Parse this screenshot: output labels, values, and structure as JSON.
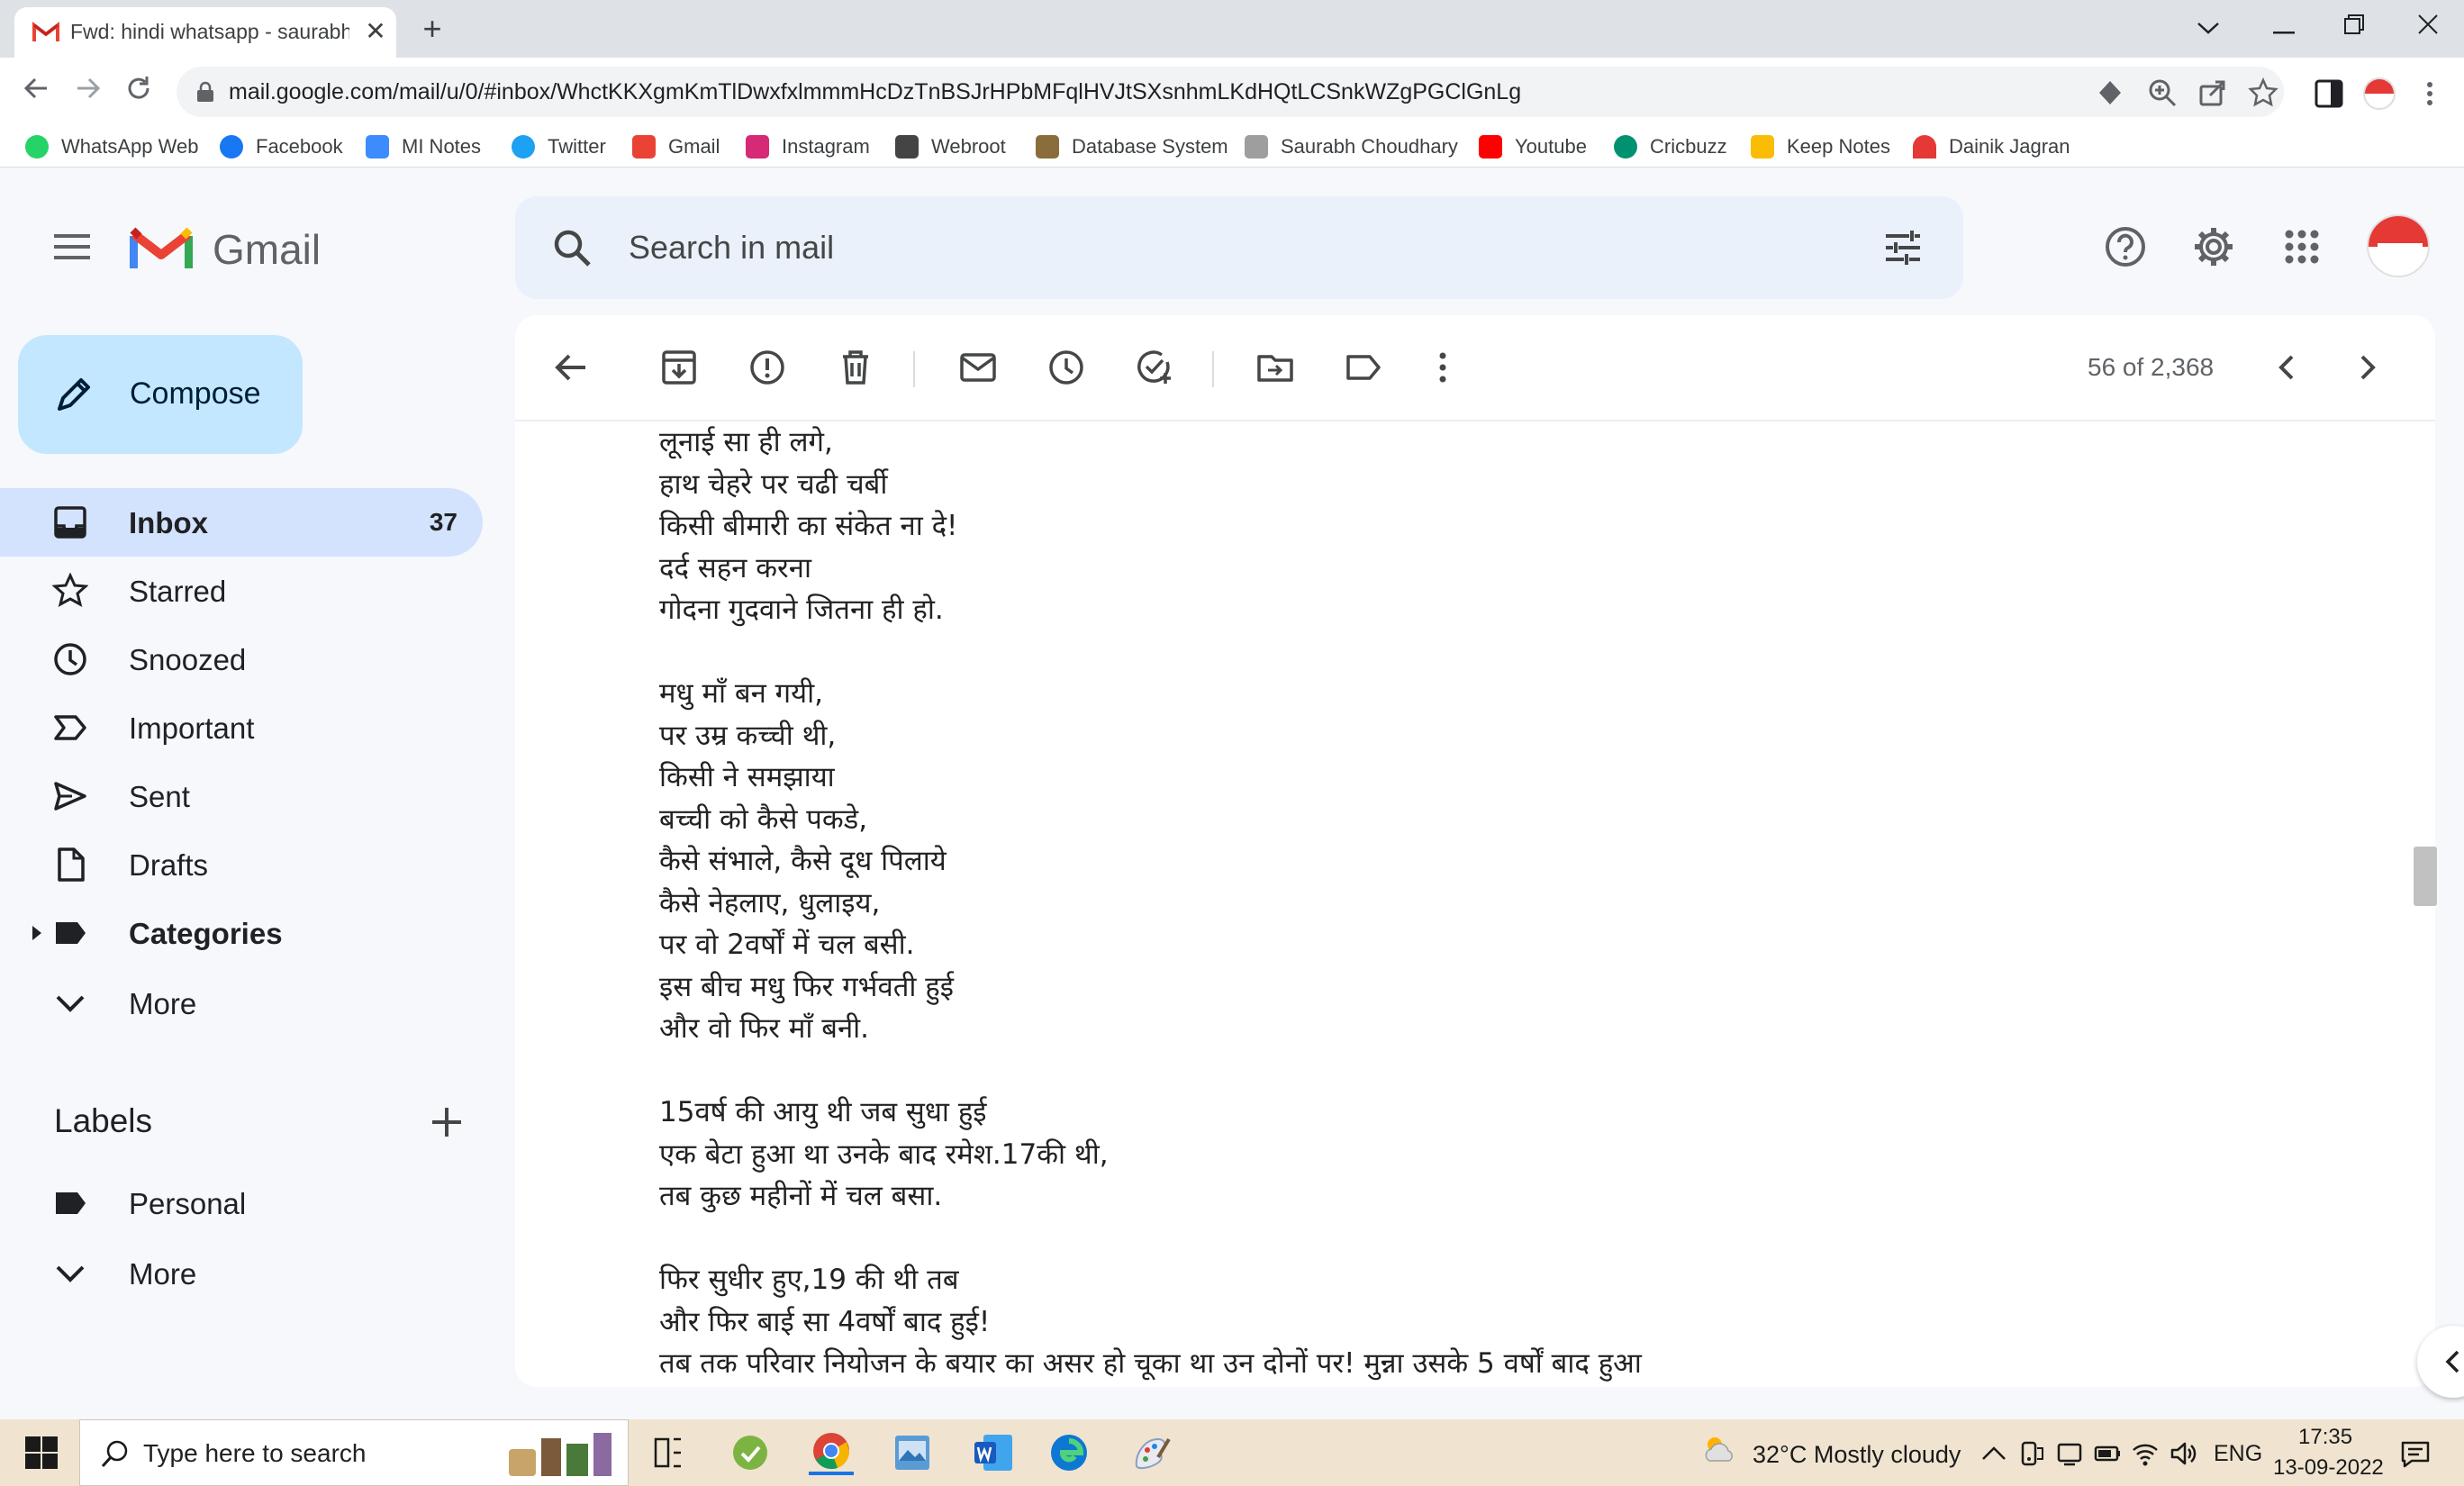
{
  "browser": {
    "tab_title": "Fwd: hindi whatsapp - saurabhch",
    "tab_close": "✕",
    "new_tab": "+",
    "url": "mail.google.com/mail/u/0/#inbox/WhctKKXgmKmTlDwxfxlmmmHcDzTnBSJrHPbMFqlHVJtSXsnhmLKdHQtLCSnkWZgPGClGnLg",
    "bookmarks": [
      {
        "label": "WhatsApp Web",
        "icon": "whatsapp-icon",
        "color": "#25d366"
      },
      {
        "label": "Facebook",
        "icon": "facebook-icon",
        "color": "#1877f2"
      },
      {
        "label": "MI Notes",
        "icon": "cloud-notes-icon",
        "color": "#3d8bfd"
      },
      {
        "label": "Twitter",
        "icon": "twitter-icon",
        "color": "#1da1f2"
      },
      {
        "label": "Gmail",
        "icon": "gmail-icon",
        "color": "#ea4335"
      },
      {
        "label": "Instagram",
        "icon": "instagram-icon",
        "color": "#d62976"
      },
      {
        "label": "Webroot",
        "icon": "webroot-icon",
        "color": "#444"
      },
      {
        "label": "Database System",
        "icon": "database-icon",
        "color": "#8a6d3b"
      },
      {
        "label": "Saurabh Choudhary",
        "icon": "document-icon",
        "color": "#9e9e9e"
      },
      {
        "label": "Youtube",
        "icon": "youtube-icon",
        "color": "#ff0000"
      },
      {
        "label": "Cricbuzz",
        "icon": "cricbuzz-icon",
        "color": "#009270"
      },
      {
        "label": "Keep Notes",
        "icon": "keep-icon",
        "color": "#fbbc04"
      },
      {
        "label": "Dainik Jagran",
        "icon": "jagran-icon",
        "color": "#e53935"
      }
    ]
  },
  "gmail": {
    "logo_text": "Gmail",
    "search_placeholder": "Search in mail",
    "compose_label": "Compose",
    "nav": [
      {
        "label": "Inbox",
        "count": "37",
        "icon": "inbox-icon"
      },
      {
        "label": "Starred",
        "count": "",
        "icon": "star-icon"
      },
      {
        "label": "Snoozed",
        "count": "",
        "icon": "clock-icon"
      },
      {
        "label": "Important",
        "count": "",
        "icon": "important-icon"
      },
      {
        "label": "Sent",
        "count": "",
        "icon": "send-icon"
      },
      {
        "label": "Drafts",
        "count": "",
        "icon": "draft-icon"
      },
      {
        "label": "Categories",
        "count": "",
        "icon": "label-icon"
      },
      {
        "label": "More",
        "count": "",
        "icon": "chevron-down-icon"
      }
    ],
    "labels_title": "Labels",
    "labels": [
      {
        "label": "Personal",
        "icon": "label-icon"
      },
      {
        "label": "More",
        "icon": "chevron-down-icon"
      }
    ],
    "pagination": "56 of 2,368",
    "accent": "#d3e3fd",
    "compose_color": "#c2e7ff"
  },
  "email": {
    "lines": [
      "लूनाई सा ही लगे,",
      "हाथ चेहरे पर चढी चर्बी",
      " किसी बीमारी का संकेत ना दे!",
      "दर्द सहन करना",
      "गोदना गुदवाने जितना ही हो.",
      "",
      "मधु माँ बन गयी,",
      "पर उम्र कच्ची थी,",
      "किसी ने समझाया",
      "बच्ची को कैसे पकडे,",
      "कैसे संभाले, कैसे दूध पिलाये",
      "कैसे नेहलाए, धुलाइय,",
      "पर वो 2वर्षों में चल बसी.",
      "इस बीच मधु फिर गर्भवती हुई",
      "और वो फिर माँ बनी.",
      "",
      "15वर्ष की आयु थी जब सुधा हुई",
      "एक बेटा हुआ था उनके बाद रमेश.17की थी,",
      "तब कुछ महीनों में चल बसा.",
      "",
      "फिर सुधीर हुए,19 की थी तब",
      "और फिर बाई सा 4वर्षों बाद हुई!",
      "तब तक परिवार नियोजन के बयार का असर हो चूका था उन दोनों पर! मुन्ना उसके 5 वर्षों बाद हुआ"
    ]
  },
  "taskbar": {
    "search_placeholder": "Type here to search",
    "weather": "32°C  Mostly cloudy",
    "language": "ENG",
    "time": "17:35",
    "date": "13-09-2022"
  }
}
